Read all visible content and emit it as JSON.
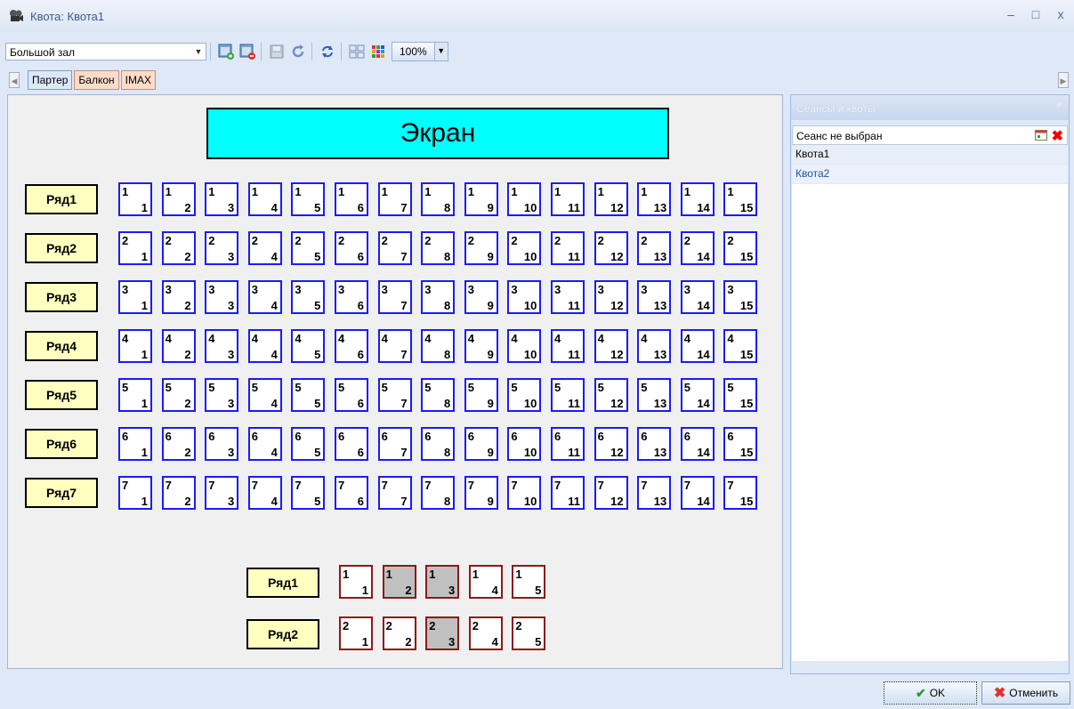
{
  "window": {
    "title": "Квота: Квота1",
    "minimize": "–",
    "maximize": "□",
    "close": "x"
  },
  "toolbar": {
    "hall_select": "Большой зал",
    "zoom_value": "100%",
    "icons": [
      "add-seat-icon",
      "remove-seat-icon",
      "save-icon",
      "undo-icon",
      "refresh-icon",
      "grid-plain-icon",
      "grid-color-icon"
    ]
  },
  "tabs": [
    {
      "label": "Партер",
      "active": true
    },
    {
      "label": "Балкон",
      "active": false
    },
    {
      "label": "IMAX",
      "active": false
    }
  ],
  "screen_label": "Экран",
  "parterre": {
    "rows": [
      {
        "label": "Ряд1",
        "row": "1",
        "seats": [
          "1",
          "2",
          "3",
          "4",
          "5",
          "6",
          "7",
          "8",
          "9",
          "10",
          "11",
          "12",
          "13",
          "14",
          "15"
        ]
      },
      {
        "label": "Ряд2",
        "row": "2",
        "seats": [
          "1",
          "2",
          "3",
          "4",
          "5",
          "6",
          "7",
          "8",
          "9",
          "10",
          "11",
          "12",
          "13",
          "14",
          "15"
        ]
      },
      {
        "label": "Ряд3",
        "row": "3",
        "seats": [
          "1",
          "2",
          "3",
          "4",
          "5",
          "6",
          "7",
          "8",
          "9",
          "10",
          "11",
          "12",
          "13",
          "14",
          "15"
        ]
      },
      {
        "label": "Ряд4",
        "row": "4",
        "seats": [
          "1",
          "2",
          "3",
          "4",
          "5",
          "6",
          "7",
          "8",
          "9",
          "10",
          "11",
          "12",
          "13",
          "14",
          "15"
        ]
      },
      {
        "label": "Ряд5",
        "row": "5",
        "seats": [
          "1",
          "2",
          "3",
          "4",
          "5",
          "6",
          "7",
          "8",
          "9",
          "10",
          "11",
          "12",
          "13",
          "14",
          "15"
        ]
      },
      {
        "label": "Ряд6",
        "row": "6",
        "seats": [
          "1",
          "2",
          "3",
          "4",
          "5",
          "6",
          "7",
          "8",
          "9",
          "10",
          "11",
          "12",
          "13",
          "14",
          "15"
        ]
      },
      {
        "label": "Ряд7",
        "row": "7",
        "seats": [
          "1",
          "2",
          "3",
          "4",
          "5",
          "6",
          "7",
          "8",
          "9",
          "10",
          "11",
          "12",
          "13",
          "14",
          "15"
        ]
      }
    ]
  },
  "balcony": {
    "rows": [
      {
        "label": "Ряд1",
        "row": "1",
        "seats": [
          "1",
          "2",
          "3",
          "4",
          "5"
        ],
        "occupied": [
          false,
          true,
          true,
          false,
          false
        ]
      },
      {
        "label": "Ряд2",
        "row": "2",
        "seats": [
          "1",
          "2",
          "3",
          "4",
          "5"
        ],
        "occupied": [
          false,
          false,
          true,
          false,
          false
        ]
      }
    ]
  },
  "panel": {
    "title": "Сеансы и квоты",
    "pin": "ᵖ",
    "session": "Сеанс не выбран",
    "quotas": [
      "Квота1",
      "Квота2"
    ]
  },
  "buttons": {
    "ok": "OK",
    "cancel": "Отменить"
  },
  "colors": {
    "seat_border": "#1a1aff",
    "balcony_border": "#8b1a1a",
    "screen": "#00ffff",
    "row_label": "#ffffc0",
    "occupied": "#c0c0c0"
  }
}
